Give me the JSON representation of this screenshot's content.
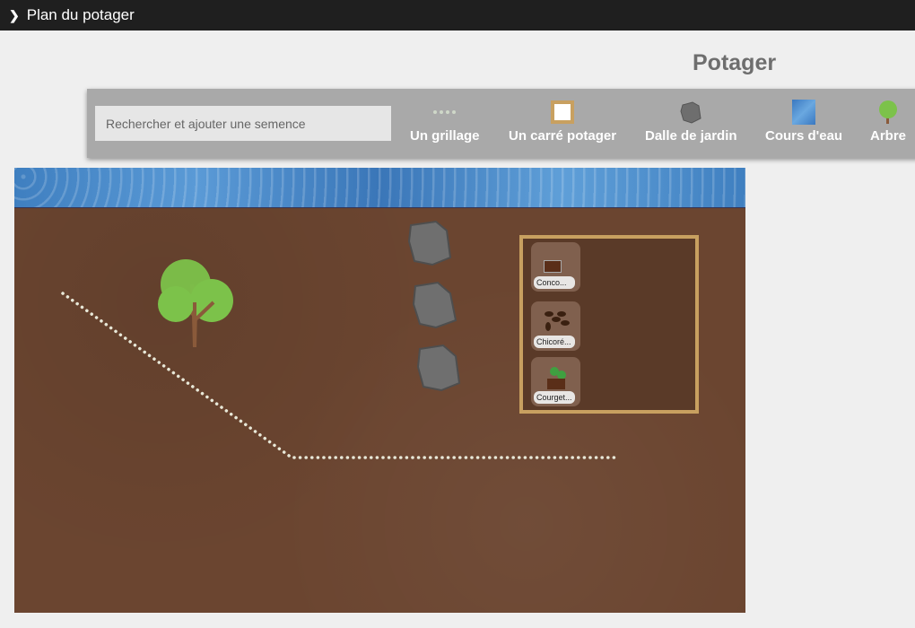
{
  "header": {
    "title": "Plan du potager"
  },
  "page": {
    "title": "Potager"
  },
  "toolbar": {
    "search_placeholder": "Rechercher et ajouter une semence",
    "tools": [
      {
        "label": "Un grillage",
        "icon": "fence-icon"
      },
      {
        "label": "Un carré potager",
        "icon": "garden-bed-icon"
      },
      {
        "label": "Dalle de jardin",
        "icon": "stone-icon"
      },
      {
        "label": "Cours d'eau",
        "icon": "water-icon"
      },
      {
        "label": "Arbre",
        "icon": "tree-icon"
      }
    ]
  },
  "bed": {
    "plants": [
      {
        "label": "Conco...",
        "icon": "cucumber-pot-icon"
      },
      {
        "label": "Chicoré...",
        "icon": "chicory-seeds-icon"
      },
      {
        "label": "Courget...",
        "icon": "zucchini-pot-icon"
      }
    ]
  },
  "colors": {
    "soil": "#6b4530",
    "bed_border": "#c8a060",
    "toolbar": "#a9a9a9",
    "fence": "#e8e8d8"
  }
}
